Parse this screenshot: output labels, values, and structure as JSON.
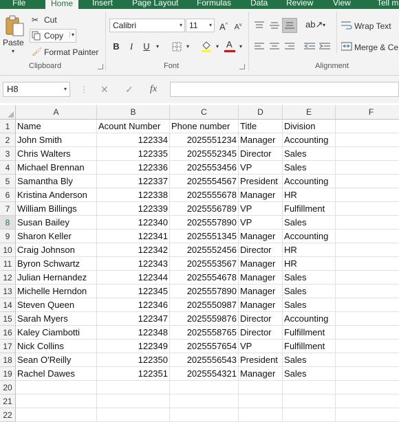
{
  "ribbon_tabs": [
    "File",
    "Home",
    "Insert",
    "Page Layout",
    "Formulas",
    "Data",
    "Review",
    "View",
    "Tell m"
  ],
  "active_tab": "Home",
  "clipboard": {
    "paste_label": "Paste",
    "cut_label": "Cut",
    "copy_label": "Copy",
    "format_painter_label": "Format Painter",
    "group_label": "Clipboard"
  },
  "font": {
    "font_name": "Calibri",
    "font_size": "11",
    "bold": "B",
    "italic": "I",
    "underline": "U",
    "group_label": "Font"
  },
  "alignment": {
    "wrap_text_label": "Wrap Text",
    "merge_label": "Merge & Ce",
    "group_label": "Alignment"
  },
  "formula_bar": {
    "name_box": "H8",
    "fx": "fx",
    "formula": ""
  },
  "columns": [
    "A",
    "B",
    "C",
    "D",
    "E",
    "F"
  ],
  "row_numbers": [
    "1",
    "2",
    "3",
    "4",
    "5",
    "6",
    "7",
    "8",
    "9",
    "10",
    "11",
    "12",
    "13",
    "14",
    "15",
    "16",
    "17",
    "18",
    "19",
    "20",
    "21",
    "22"
  ],
  "selected_row": "8",
  "headers": [
    "Name",
    "Acount Number",
    "Phone number",
    "Title",
    "Division"
  ],
  "rows": [
    [
      "John Smith",
      "122334",
      "2025551234",
      "Manager",
      "Accounting"
    ],
    [
      "Chris Walters",
      "122335",
      "2025552345",
      "Director",
      "Sales"
    ],
    [
      "Michael Brennan",
      "122336",
      "2025553456",
      "VP",
      "Sales"
    ],
    [
      "Samantha Bly",
      "122337",
      "2025554567",
      "President",
      "Accounting"
    ],
    [
      "Kristina Anderson",
      "122338",
      "2025555678",
      "Manager",
      "HR"
    ],
    [
      "William Billings",
      "122339",
      "2025556789",
      "VP",
      "Fulfillment"
    ],
    [
      "Susan Bailey",
      "122340",
      "2025557890",
      "VP",
      "Sales"
    ],
    [
      "Sharon Keller",
      "122341",
      "2025551345",
      "Manager",
      "Accounting"
    ],
    [
      "Craig Johnson",
      "122342",
      "2025552456",
      "Director",
      "HR"
    ],
    [
      "Byron Schwartz",
      "122343",
      "2025553567",
      "Manager",
      "HR"
    ],
    [
      "Julian Hernandez",
      "122344",
      "2025554678",
      "Manager",
      "Sales"
    ],
    [
      "Michelle Herndon",
      "122345",
      "2025557890",
      "Manager",
      "Sales"
    ],
    [
      "Steven Queen",
      "122346",
      "2025550987",
      "Manager",
      "Sales"
    ],
    [
      "Sarah Myers",
      "122347",
      "2025559876",
      "Director",
      "Accounting"
    ],
    [
      "Kaley Ciambotti",
      "122348",
      "2025558765",
      "Director",
      "Fulfillment"
    ],
    [
      "Nick Collins",
      "122349",
      "2025557654",
      "VP",
      "Fulfillment"
    ],
    [
      "Sean O'Reilly",
      "122350",
      "2025556543",
      "President",
      "Sales"
    ],
    [
      "Rachel Dawes",
      "122351",
      "2025554321",
      "Manager",
      "Sales"
    ]
  ],
  "colors": {
    "excel_green": "#217346",
    "ribbon_bg": "#f3f3f3",
    "gridline": "#e1e1e1"
  }
}
